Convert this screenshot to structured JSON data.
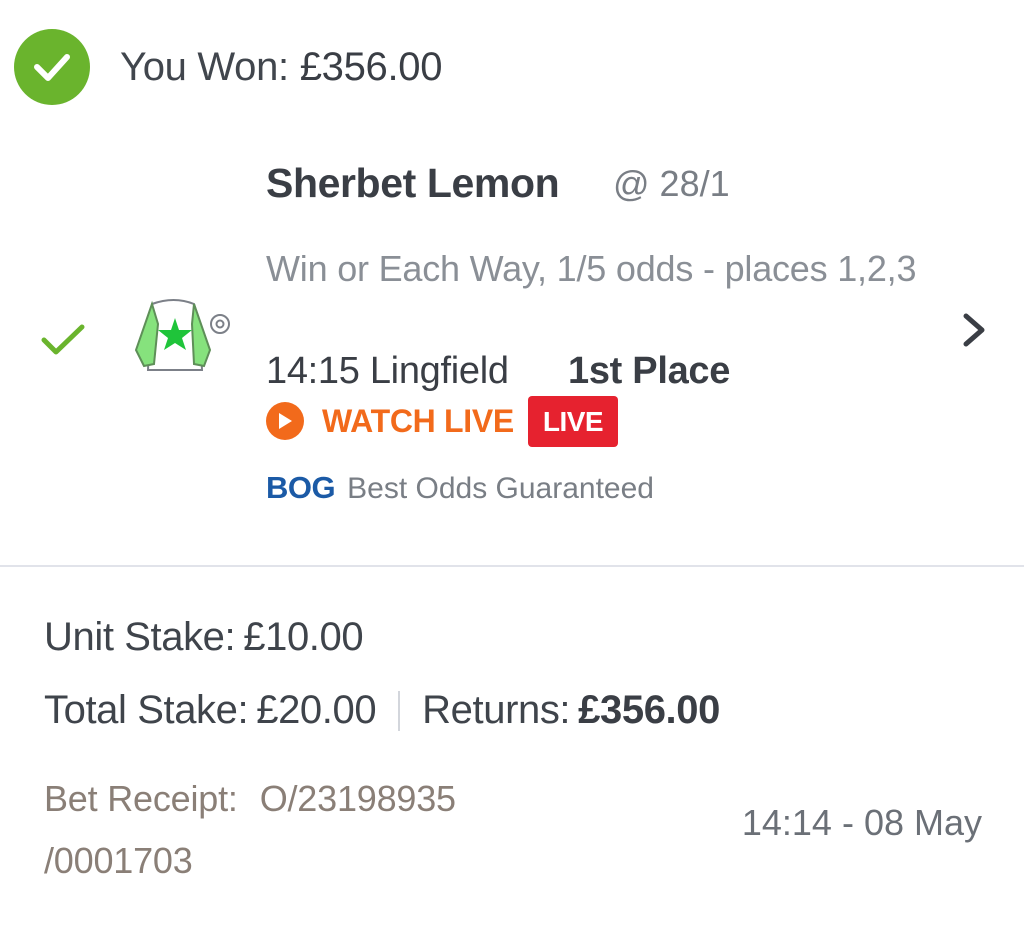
{
  "header": {
    "won_label": "You Won:",
    "won_amount": "£356.00",
    "status_icon": "check-circle-icon",
    "status_color": "#6ab42d"
  },
  "selection": {
    "result_icon": "check-icon",
    "silks_icon": "jockey-silks-icon",
    "horse_name": "Sherbet Lemon",
    "odds": "@ 28/1",
    "market": "Win or Each Way, 1/5 odds - places 1,2,3",
    "race": "14:15 Lingfield",
    "result": "1st Place",
    "watch_live_label": "WATCH LIVE",
    "live_badge": "LIVE",
    "bog_code": "BOG",
    "bog_text": "Best Odds Guaranteed"
  },
  "stakes": {
    "unit_stake_label": "Unit Stake:",
    "unit_stake_value": "£10.00",
    "total_stake_label": "Total Stake:",
    "total_stake_value": "£20.00",
    "returns_label": "Returns:",
    "returns_value": "£356.00"
  },
  "receipt": {
    "label": "Bet Receipt:",
    "number_part1": "O/23198935",
    "number_part2": "/0001703",
    "placed_time": "14:14 - 08 May"
  },
  "colors": {
    "accent_orange": "#f26a1b",
    "live_red": "#e6222f",
    "bog_blue": "#1b5aa6",
    "win_green": "#6ab42d"
  }
}
